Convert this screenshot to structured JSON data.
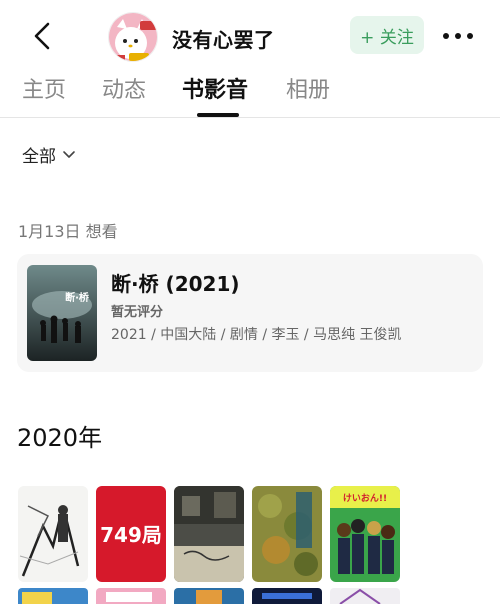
{
  "header": {
    "username": "没有心罢了",
    "follow_label": "+ 关注"
  },
  "tabs": [
    {
      "label": "主页"
    },
    {
      "label": "动态"
    },
    {
      "label": "书影音"
    },
    {
      "label": "相册"
    }
  ],
  "filter": {
    "label": "全部"
  },
  "section": {
    "date_label": "1月13日 想看"
  },
  "card": {
    "title": "断·桥 (2021)",
    "rating": "暂无评分",
    "meta": "2021 / 中国大陆 / 剧情 / 李玉 / 马思纯 王俊凯",
    "poster_text": "断·桥"
  },
  "year_label": "2020年",
  "posters_row1": [
    {
      "name": "poster-1",
      "text": ""
    },
    {
      "name": "poster-749",
      "text": "749局"
    },
    {
      "name": "poster-3",
      "text": ""
    },
    {
      "name": "poster-4",
      "text": ""
    },
    {
      "name": "poster-5",
      "text": "けいおん!!"
    }
  ],
  "colors": {
    "accent_green": "#3a9d5d",
    "follow_bg": "#e6f5ec"
  }
}
